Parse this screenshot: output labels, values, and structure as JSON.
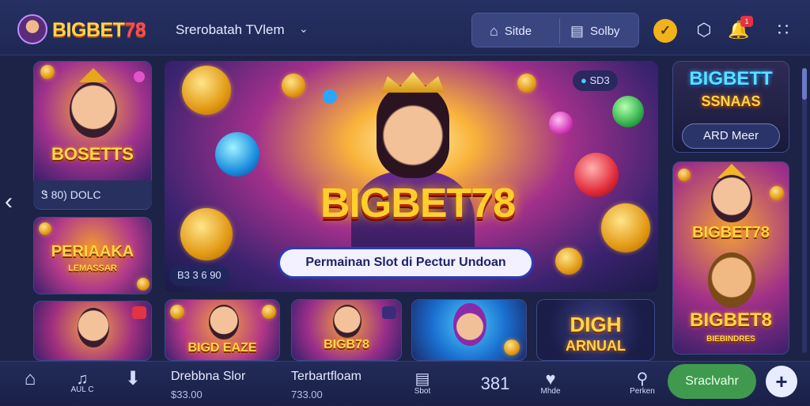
{
  "brand": {
    "logo_text_a": "BIGBET",
    "logo_text_b": "78"
  },
  "header": {
    "nav_title": "Srerobatah TVlem",
    "seg_buttons": [
      {
        "label": "Sitde",
        "icon": "home-icon"
      },
      {
        "label": "Solby",
        "icon": "wallet-icon"
      }
    ],
    "icons": [
      "coin-badge-icon",
      "settings-icon",
      "notification-icon",
      "apps-grid-icon"
    ],
    "notification_count": "1"
  },
  "left_column": {
    "card1_title": "BOSETTS",
    "card1_caption": "Ꮥ  80) DOLC",
    "card2_title": "PERIAAKA",
    "card2_sub": "LEMASSAR",
    "card3_title": ""
  },
  "banner": {
    "title": "BIGBET78",
    "subtitle": "Permainan Slot di Pectur Undoan",
    "top_pill": "SD3",
    "bottom_pill": "B3 3 6 90"
  },
  "bottom_cards": [
    {
      "title": "BIGD EAZE"
    },
    {
      "title": "BIGB78"
    },
    {
      "title": ""
    },
    {
      "title": "DIGH",
      "sub": "ARNUAL"
    }
  ],
  "right_column": {
    "top_title": "BIGBETT",
    "top_sub": "SSNAAS",
    "top_button": "ARD Meer",
    "card_title1": "BIGBET78",
    "card_title2": "BIGBET8",
    "card_sub": "BIEBINDRES"
  },
  "bottombar": {
    "items": [
      {
        "label": "",
        "icon": "home-icon"
      },
      {
        "label": "AUL C",
        "icon": "music-icon"
      },
      {
        "label": "",
        "icon": "download-icon"
      }
    ],
    "text1": "Drebbna Slor",
    "text1_sub": "$33.00",
    "text2": "Terbartfloam",
    "text2_sub": "733.00",
    "item_sbot": {
      "label": "Sbot",
      "icon": "slot-machine-icon"
    },
    "glyph_text": "381",
    "item_mhde": {
      "label": "Mhde",
      "icon": "heart-icon"
    },
    "item_perken": {
      "label": "Perken",
      "icon": "search-icon"
    },
    "cta_label": "Sraclvahr",
    "plus_icon": "plus-icon"
  }
}
